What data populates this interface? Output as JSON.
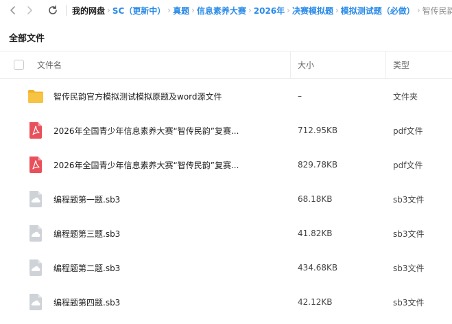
{
  "nav": {
    "back_icon": "chevron-left-icon",
    "forward_icon": "chevron-right-icon",
    "refresh_icon": "refresh-icon"
  },
  "breadcrumb": [
    {
      "label": "我的网盘",
      "kind": "root"
    },
    {
      "label": "SC（更新中）",
      "kind": "link"
    },
    {
      "label": "真题",
      "kind": "link"
    },
    {
      "label": "信息素养大赛",
      "kind": "link"
    },
    {
      "label": "2026年",
      "kind": "link"
    },
    {
      "label": "决赛模拟题",
      "kind": "link"
    },
    {
      "label": "模拟测试题（必做）",
      "kind": "link"
    },
    {
      "label": "智传民韵",
      "kind": "current"
    }
  ],
  "breadcrumb_separator": "›",
  "section_title": "全部文件",
  "table": {
    "columns": {
      "name": "文件名",
      "size": "大小",
      "type": "类型"
    },
    "rows": [
      {
        "icon": "folder-icon",
        "name": "智传民韵官方模拟测试模拟原题及word源文件",
        "size": "–",
        "type": "文件夹"
      },
      {
        "icon": "pdf-icon",
        "name": "2026年全国青少年信息素养大赛“智传民韵”复赛...",
        "size": "712.95KB",
        "type": "pdf文件"
      },
      {
        "icon": "pdf-icon",
        "name": "2026年全国青少年信息素养大赛“智传民韵”复赛...",
        "size": "829.78KB",
        "type": "pdf文件"
      },
      {
        "icon": "cloud-file-icon",
        "name": "编程题第一题.sb3",
        "size": "68.18KB",
        "type": "sb3文件"
      },
      {
        "icon": "cloud-file-icon",
        "name": "编程题第三题.sb3",
        "size": "41.82KB",
        "type": "sb3文件"
      },
      {
        "icon": "cloud-file-icon",
        "name": "编程题第二题.sb3",
        "size": "434.68KB",
        "type": "sb3文件"
      },
      {
        "icon": "cloud-file-icon",
        "name": "编程题第四题.sb3",
        "size": "42.12KB",
        "type": "sb3文件"
      }
    ]
  },
  "colors": {
    "link": "#2b8be8",
    "folder": "#f7c344",
    "pdf": "#e8505b",
    "generic_file": "#cfd3d8"
  }
}
